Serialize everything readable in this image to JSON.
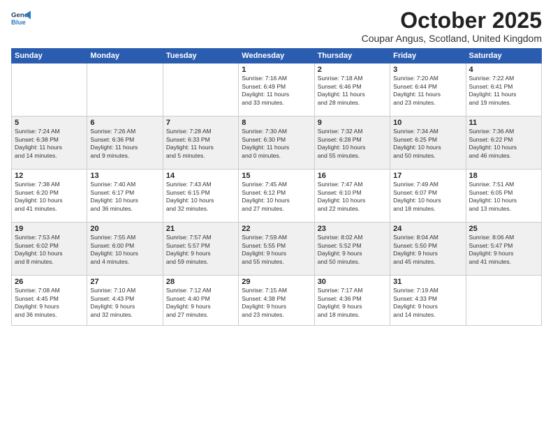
{
  "logo": {
    "line1": "General",
    "line2": "Blue"
  },
  "title": "October 2025",
  "location": "Coupar Angus, Scotland, United Kingdom",
  "days_header": [
    "Sunday",
    "Monday",
    "Tuesday",
    "Wednesday",
    "Thursday",
    "Friday",
    "Saturday"
  ],
  "weeks": [
    [
      {
        "day": "",
        "info": ""
      },
      {
        "day": "",
        "info": ""
      },
      {
        "day": "",
        "info": ""
      },
      {
        "day": "1",
        "info": "Sunrise: 7:16 AM\nSunset: 6:49 PM\nDaylight: 11 hours\nand 33 minutes."
      },
      {
        "day": "2",
        "info": "Sunrise: 7:18 AM\nSunset: 6:46 PM\nDaylight: 11 hours\nand 28 minutes."
      },
      {
        "day": "3",
        "info": "Sunrise: 7:20 AM\nSunset: 6:44 PM\nDaylight: 11 hours\nand 23 minutes."
      },
      {
        "day": "4",
        "info": "Sunrise: 7:22 AM\nSunset: 6:41 PM\nDaylight: 11 hours\nand 19 minutes."
      }
    ],
    [
      {
        "day": "5",
        "info": "Sunrise: 7:24 AM\nSunset: 6:38 PM\nDaylight: 11 hours\nand 14 minutes."
      },
      {
        "day": "6",
        "info": "Sunrise: 7:26 AM\nSunset: 6:36 PM\nDaylight: 11 hours\nand 9 minutes."
      },
      {
        "day": "7",
        "info": "Sunrise: 7:28 AM\nSunset: 6:33 PM\nDaylight: 11 hours\nand 5 minutes."
      },
      {
        "day": "8",
        "info": "Sunrise: 7:30 AM\nSunset: 6:30 PM\nDaylight: 11 hours\nand 0 minutes."
      },
      {
        "day": "9",
        "info": "Sunrise: 7:32 AM\nSunset: 6:28 PM\nDaylight: 10 hours\nand 55 minutes."
      },
      {
        "day": "10",
        "info": "Sunrise: 7:34 AM\nSunset: 6:25 PM\nDaylight: 10 hours\nand 50 minutes."
      },
      {
        "day": "11",
        "info": "Sunrise: 7:36 AM\nSunset: 6:22 PM\nDaylight: 10 hours\nand 46 minutes."
      }
    ],
    [
      {
        "day": "12",
        "info": "Sunrise: 7:38 AM\nSunset: 6:20 PM\nDaylight: 10 hours\nand 41 minutes."
      },
      {
        "day": "13",
        "info": "Sunrise: 7:40 AM\nSunset: 6:17 PM\nDaylight: 10 hours\nand 36 minutes."
      },
      {
        "day": "14",
        "info": "Sunrise: 7:43 AM\nSunset: 6:15 PM\nDaylight: 10 hours\nand 32 minutes."
      },
      {
        "day": "15",
        "info": "Sunrise: 7:45 AM\nSunset: 6:12 PM\nDaylight: 10 hours\nand 27 minutes."
      },
      {
        "day": "16",
        "info": "Sunrise: 7:47 AM\nSunset: 6:10 PM\nDaylight: 10 hours\nand 22 minutes."
      },
      {
        "day": "17",
        "info": "Sunrise: 7:49 AM\nSunset: 6:07 PM\nDaylight: 10 hours\nand 18 minutes."
      },
      {
        "day": "18",
        "info": "Sunrise: 7:51 AM\nSunset: 6:05 PM\nDaylight: 10 hours\nand 13 minutes."
      }
    ],
    [
      {
        "day": "19",
        "info": "Sunrise: 7:53 AM\nSunset: 6:02 PM\nDaylight: 10 hours\nand 8 minutes."
      },
      {
        "day": "20",
        "info": "Sunrise: 7:55 AM\nSunset: 6:00 PM\nDaylight: 10 hours\nand 4 minutes."
      },
      {
        "day": "21",
        "info": "Sunrise: 7:57 AM\nSunset: 5:57 PM\nDaylight: 9 hours\nand 59 minutes."
      },
      {
        "day": "22",
        "info": "Sunrise: 7:59 AM\nSunset: 5:55 PM\nDaylight: 9 hours\nand 55 minutes."
      },
      {
        "day": "23",
        "info": "Sunrise: 8:02 AM\nSunset: 5:52 PM\nDaylight: 9 hours\nand 50 minutes."
      },
      {
        "day": "24",
        "info": "Sunrise: 8:04 AM\nSunset: 5:50 PM\nDaylight: 9 hours\nand 45 minutes."
      },
      {
        "day": "25",
        "info": "Sunrise: 8:06 AM\nSunset: 5:47 PM\nDaylight: 9 hours\nand 41 minutes."
      }
    ],
    [
      {
        "day": "26",
        "info": "Sunrise: 7:08 AM\nSunset: 4:45 PM\nDaylight: 9 hours\nand 36 minutes."
      },
      {
        "day": "27",
        "info": "Sunrise: 7:10 AM\nSunset: 4:43 PM\nDaylight: 9 hours\nand 32 minutes."
      },
      {
        "day": "28",
        "info": "Sunrise: 7:12 AM\nSunset: 4:40 PM\nDaylight: 9 hours\nand 27 minutes."
      },
      {
        "day": "29",
        "info": "Sunrise: 7:15 AM\nSunset: 4:38 PM\nDaylight: 9 hours\nand 23 minutes."
      },
      {
        "day": "30",
        "info": "Sunrise: 7:17 AM\nSunset: 4:36 PM\nDaylight: 9 hours\nand 18 minutes."
      },
      {
        "day": "31",
        "info": "Sunrise: 7:19 AM\nSunset: 4:33 PM\nDaylight: 9 hours\nand 14 minutes."
      },
      {
        "day": "",
        "info": ""
      }
    ]
  ]
}
